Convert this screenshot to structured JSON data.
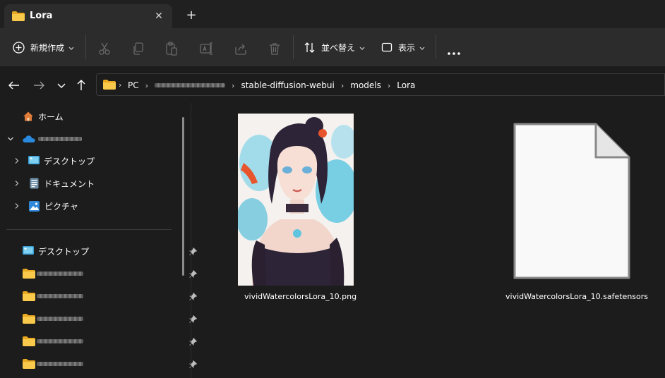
{
  "tab": {
    "title": "Lora",
    "close_glyph": "✕",
    "new_tab_glyph": "+"
  },
  "toolbar": {
    "new_label": "新規作成",
    "sort_label": "並べ替え",
    "view_label": "表示",
    "more_glyph": "•••",
    "icons": [
      "cut-icon",
      "copy-icon",
      "paste-icon",
      "rename-icon",
      "share-icon",
      "delete-icon"
    ]
  },
  "address": {
    "crumbs": [
      "PC",
      "stable-diffusion-webui",
      "models",
      "Lora"
    ]
  },
  "sidebar": {
    "home": "ホーム",
    "onedrive_children": [
      "デスクトップ",
      "ドキュメント",
      "ピクチャ"
    ],
    "quick_access": [
      "デスクトップ"
    ]
  },
  "files": [
    {
      "name": "vividWatercolorsLora_10.png"
    },
    {
      "name": "vividWatercolorsLora_10.safetensors"
    }
  ],
  "colors": {
    "background": "#1c1c1c",
    "toolbar": "#2c2c2c",
    "folder": "#f5c542",
    "onedrive": "#2a8ae0"
  }
}
